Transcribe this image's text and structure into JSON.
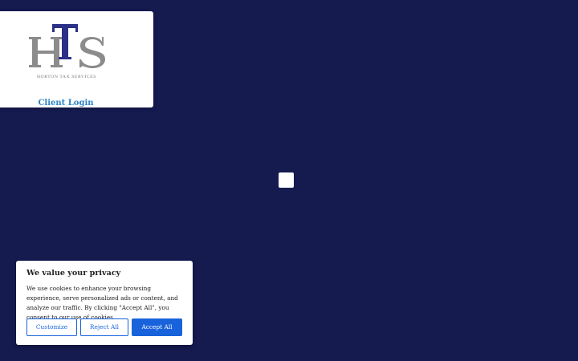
{
  "header": {
    "logo_monogram": "HTS",
    "logo_company": "HORTON TAX SERVICES",
    "client_login_label": "Client Login"
  },
  "cookie_banner": {
    "title": "We value your privacy",
    "body": "We use cookies to enhance your browsing experience, serve personalized ads or content, and analyze our traffic. By clicking \"Accept All\", you consent to our use of cookies.",
    "customize_label": "Customize",
    "reject_label": "Reject All",
    "accept_label": "Accept All"
  },
  "colors": {
    "page_background": "#151a4f",
    "logo_gray": "#8c8c8c",
    "logo_navy": "#2a3187",
    "link_blue": "#2c83c7",
    "button_blue": "#1863dc"
  },
  "icons": {
    "loader": "loading-spinner-icon"
  }
}
